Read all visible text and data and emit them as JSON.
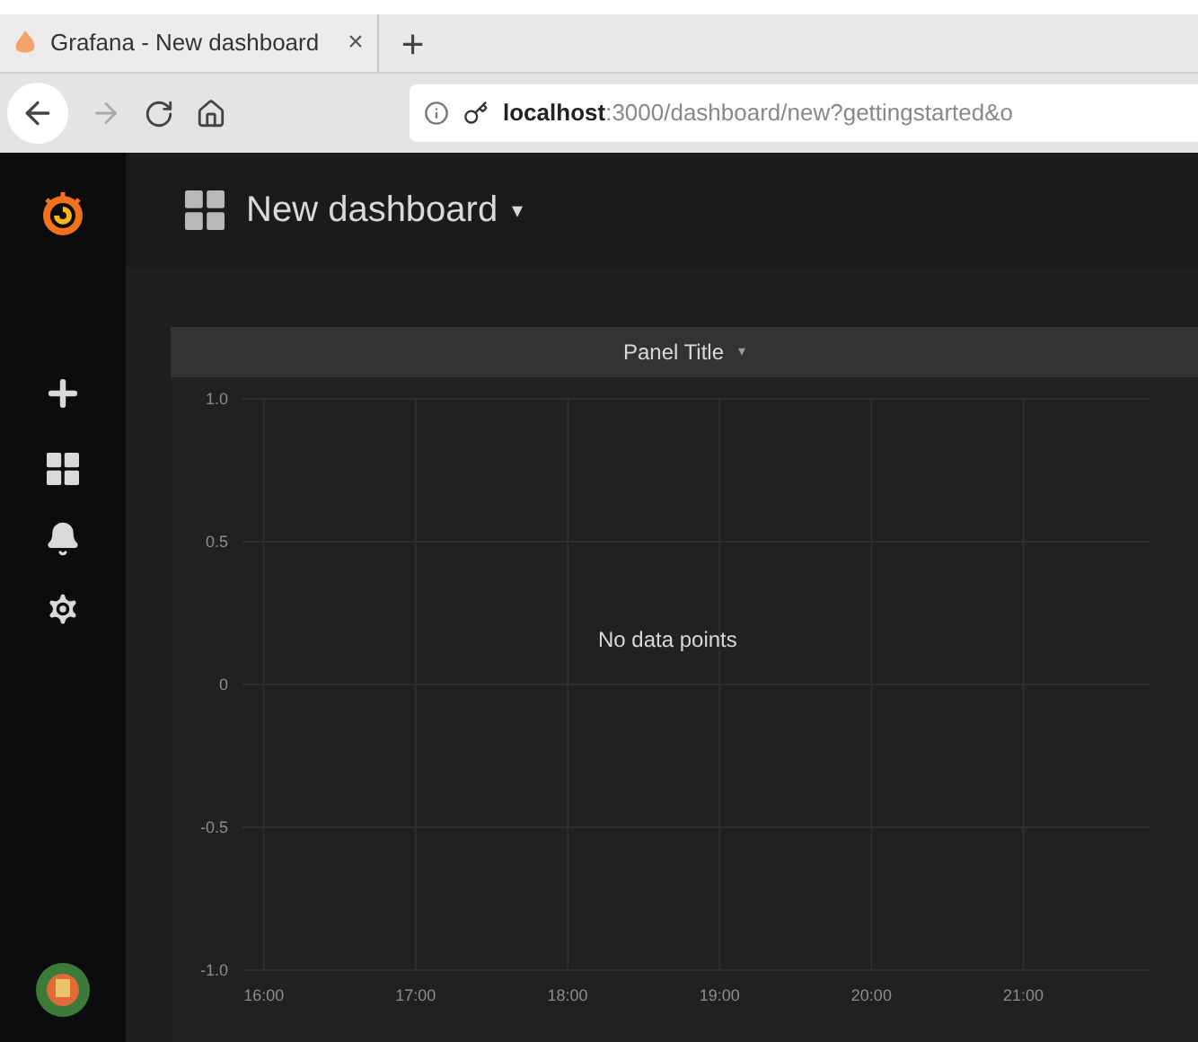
{
  "browser": {
    "tab": {
      "title": "Grafana - New dashboard",
      "close": "×"
    },
    "new_tab": "+",
    "url_host": "localhost",
    "url_rest": ":3000/dashboard/new?gettingstarted&o"
  },
  "dashboard": {
    "title": "New dashboard",
    "title_caret": "▾"
  },
  "panel": {
    "title": "Panel Title",
    "title_caret": "▾",
    "message": "No data points",
    "chart_data": {
      "type": "line",
      "grid": true,
      "xlim": [
        15.86,
        21.83
      ],
      "ylim": [
        -1,
        1
      ],
      "xticks": [
        {
          "value": 16,
          "label": "16:00"
        },
        {
          "value": 17,
          "label": "17:00"
        },
        {
          "value": 18,
          "label": "18:00"
        },
        {
          "value": 19,
          "label": "19:00"
        },
        {
          "value": 20,
          "label": "20:00"
        },
        {
          "value": 21,
          "label": "21:00"
        }
      ],
      "yticks": [
        {
          "value": 1,
          "label": "1.0"
        },
        {
          "value": 0.5,
          "label": "0.5"
        },
        {
          "value": 0,
          "label": "0"
        },
        {
          "value": -0.5,
          "label": "-0.5"
        },
        {
          "value": -1,
          "label": "-1.0"
        }
      ]
    }
  }
}
